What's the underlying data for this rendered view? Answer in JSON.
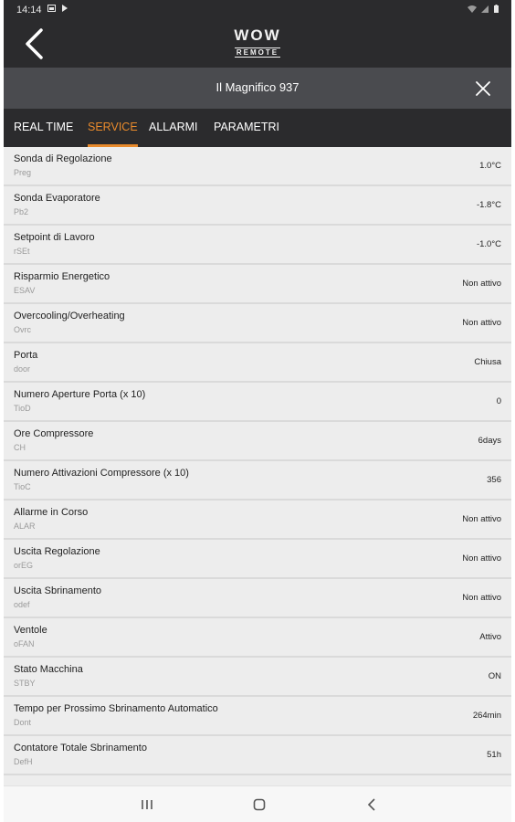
{
  "status_bar": {
    "time": "14:14"
  },
  "app_bar": {
    "logo_main": "WOW",
    "logo_sub": "REMOTE"
  },
  "device": {
    "name": "Il Magnifico 937"
  },
  "tabs": [
    {
      "label": "REAL TIME",
      "active": false
    },
    {
      "label": "SERVICE",
      "active": true
    },
    {
      "label": "ALLARMI",
      "active": false
    },
    {
      "label": "PARAMETRI",
      "active": false
    }
  ],
  "colors": {
    "accent": "#e88a2c",
    "header_bg": "#2b2b2d",
    "device_bar_bg": "#4a4b4f",
    "list_bg": "#ededed"
  },
  "items": [
    {
      "label": "Sonda di Regolazione",
      "code": "Preg",
      "value": "1.0°C"
    },
    {
      "label": "Sonda Evaporatore",
      "code": "Pb2",
      "value": "-1.8°C"
    },
    {
      "label": "Setpoint di Lavoro",
      "code": "rSEt",
      "value": "-1.0°C"
    },
    {
      "label": "Risparmio Energetico",
      "code": "ESAV",
      "value": "Non attivo"
    },
    {
      "label": "Overcooling/Overheating",
      "code": "Ovrc",
      "value": "Non attivo"
    },
    {
      "label": "Porta",
      "code": "door",
      "value": "Chiusa"
    },
    {
      "label": "Numero Aperture Porta (x 10)",
      "code": "TioD",
      "value": "0"
    },
    {
      "label": "Ore Compressore",
      "code": "CH",
      "value": "6days"
    },
    {
      "label": "Numero Attivazioni Compressore (x 10)",
      "code": "TioC",
      "value": "356"
    },
    {
      "label": "Allarme in Corso",
      "code": "ALAR",
      "value": "Non attivo"
    },
    {
      "label": "Uscita Regolazione",
      "code": "orEG",
      "value": "Non attivo"
    },
    {
      "label": "Uscita Sbrinamento",
      "code": "odef",
      "value": "Non attivo"
    },
    {
      "label": "Ventole",
      "code": "oFAN",
      "value": "Attivo"
    },
    {
      "label": "Stato Macchina",
      "code": "STBY",
      "value": "ON"
    },
    {
      "label": "Tempo per Prossimo Sbrinamento Automatico",
      "code": "Dont",
      "value": "264min"
    },
    {
      "label": "Contatore Totale Sbrinamento",
      "code": "DefH",
      "value": "51h"
    }
  ],
  "icons": {
    "back": "back-arrow-icon",
    "close": "close-icon",
    "recents": "recents-icon",
    "home": "home-icon",
    "nav_back": "nav-back-icon"
  }
}
